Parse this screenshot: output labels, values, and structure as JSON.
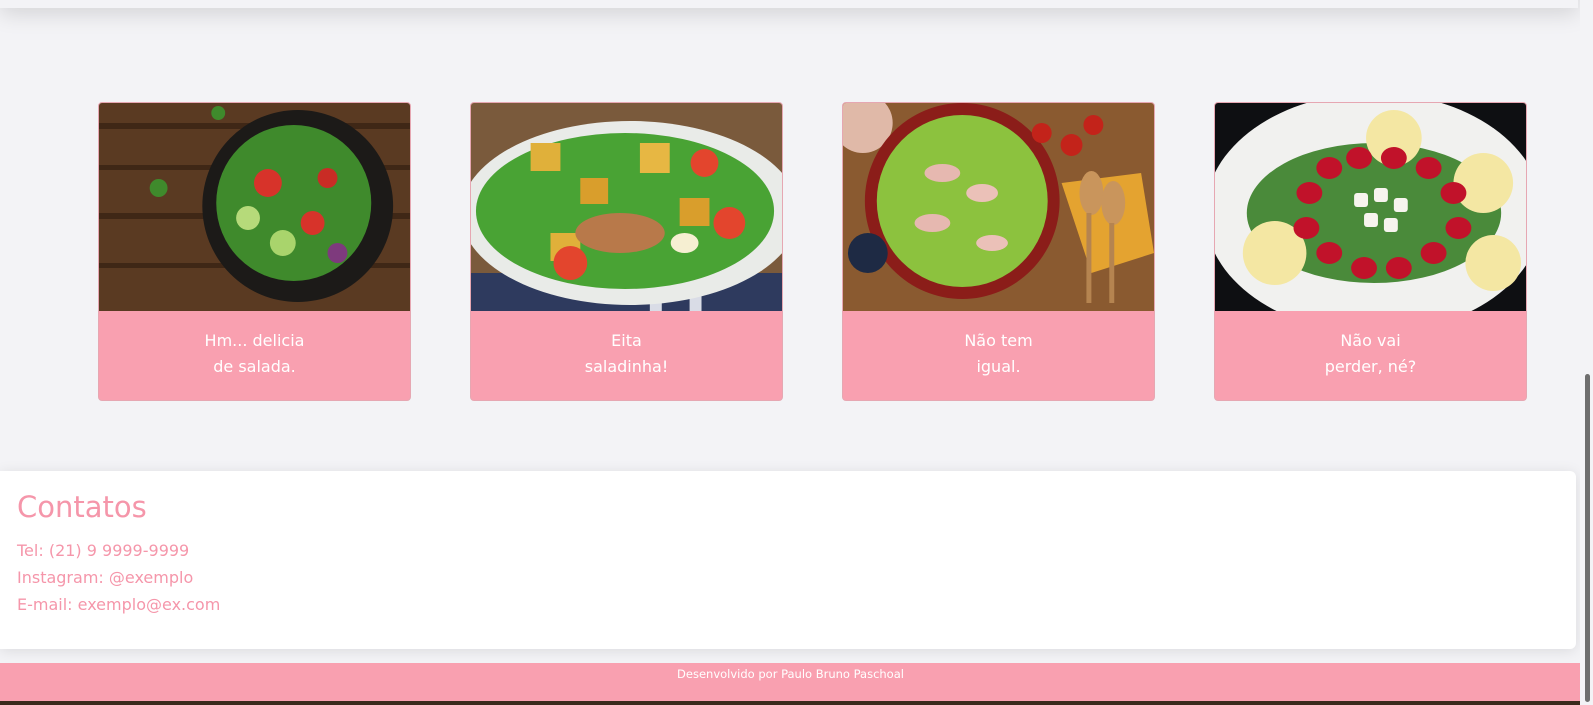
{
  "cards": [
    {
      "image_icon": "salad-bowl-dark-wood-image",
      "line1": "Hm... delicia",
      "line2": "de salada."
    },
    {
      "image_icon": "chicken-caesar-salad-image",
      "line1": "Eita",
      "line2": "saladinha!"
    },
    {
      "image_icon": "ham-salad-bowl-image",
      "line1": "Não tem",
      "line2": "igual."
    },
    {
      "image_icon": "tomato-palm-salad-image",
      "line1": "Não vai",
      "line2": "perder, né?"
    }
  ],
  "contacts": {
    "title": "Contatos",
    "phone": "Tel: (21) 9 9999-9999",
    "instagram": "Instagram: @exemplo",
    "email": "E-mail: exemplo@ex.com"
  },
  "footer": {
    "credit": "Desenvolvido por Paulo Bruno Paschoal"
  },
  "colors": {
    "accent_pink": "#f9a0b0",
    "text_pink": "#f596aa",
    "background": "#f3f3f6"
  }
}
